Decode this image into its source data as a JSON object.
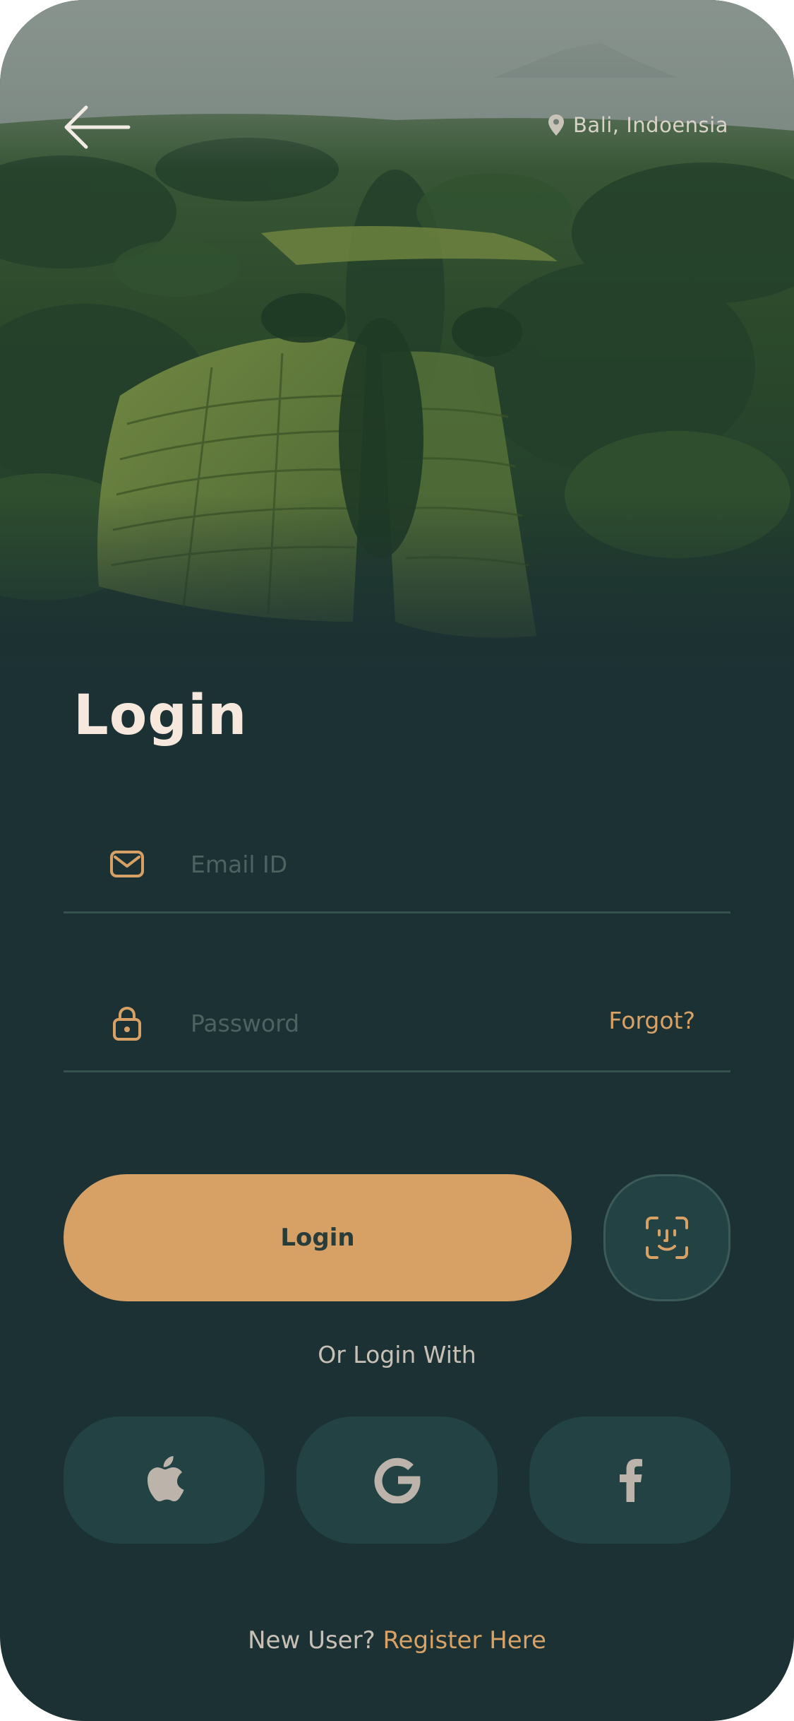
{
  "header": {
    "back_icon": "arrow-left-icon",
    "location_icon": "map-pin-icon",
    "location_text": "Bali, Indoensia"
  },
  "title": "Login",
  "form": {
    "email": {
      "icon": "mail-icon",
      "value": "",
      "placeholder": "Email ID"
    },
    "password": {
      "icon": "lock-icon",
      "value": "",
      "placeholder": "Password",
      "forgot_label": "Forgot?"
    },
    "login_label": "Login",
    "face_id_icon": "face-id-icon"
  },
  "alt_login": {
    "label": "Or Login With",
    "providers": [
      {
        "name": "Apple",
        "icon": "apple-icon"
      },
      {
        "name": "Google",
        "icon": "google-icon"
      },
      {
        "name": "Facebook",
        "icon": "facebook-icon"
      }
    ]
  },
  "footer": {
    "prompt": "New User?",
    "register_label": "Register Here"
  },
  "colors": {
    "background": "#1c3133",
    "accent": "#d7a166",
    "title": "#f6e8dc",
    "card": "#234243",
    "divider": "#37514f",
    "muted_text": "#c8c0b6",
    "placeholder": "#4c6461"
  }
}
